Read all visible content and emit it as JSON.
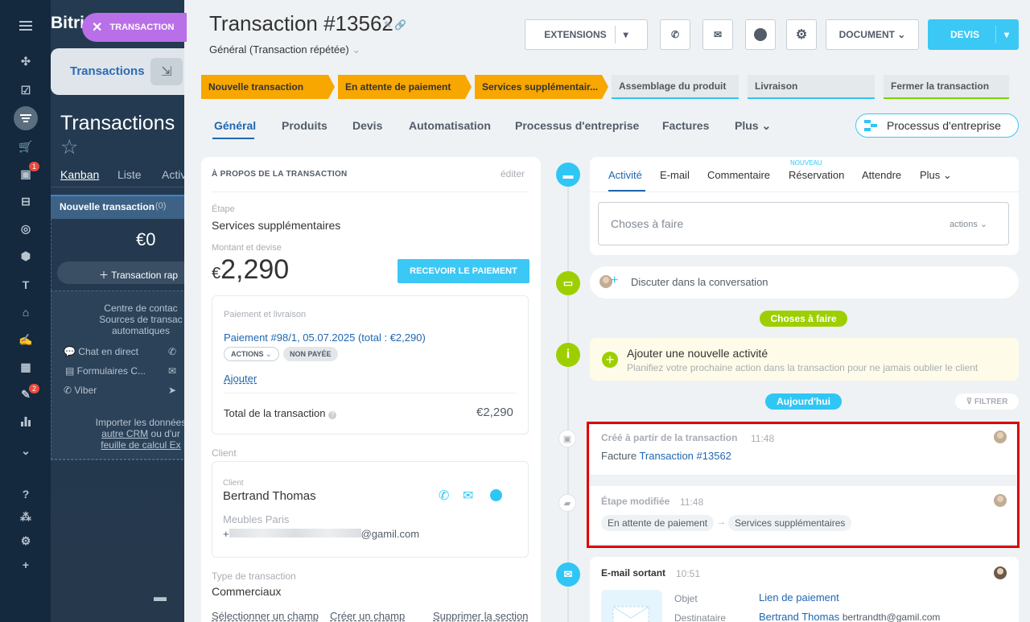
{
  "app": {
    "logo": "Bitri"
  },
  "sidebar_icons": [
    "menu-icon",
    "sites-icon",
    "tasks-icon",
    "crm-icon",
    "shop-icon",
    "contact-center-icon",
    "bot-icon",
    "goal-icon",
    "box-icon",
    "text-icon",
    "bank-icon",
    "sign-icon",
    "calendar-icon",
    "edit-icon",
    "analytics-icon",
    "more-icon",
    "help-icon",
    "structure-icon",
    "settings-icon",
    "add-icon",
    "printer-icon"
  ],
  "sidebar_badges": {
    "contact_center": "1",
    "edit": "2"
  },
  "background": {
    "tab_label": "Transactions",
    "page_title": "Transactions",
    "views": [
      "Kanban",
      "Liste",
      "Activ"
    ],
    "column_title": "Nouvelle transaction",
    "column_count": "(0)",
    "column_amount": "€0",
    "quick_add": "Transaction rap",
    "center_lines": [
      "Centre de contac",
      "Sources de transac",
      "automatiques"
    ],
    "sources": [
      "Chat en direct",
      "Formulaires C...",
      "Viber"
    ],
    "import_lines": [
      "Importer les données",
      "autre CRM",
      "ou d'ur",
      "feuille de calcul Ex"
    ]
  },
  "chip": {
    "label": "TRANSACTION"
  },
  "header": {
    "title": "Transaction #13562",
    "subtitle": "Général (Transaction répétée)",
    "extensions_label": "EXTENSIONS",
    "document_label": "DOCUMENT",
    "devis_label": "DEVIS"
  },
  "stages": [
    {
      "label": "Nouvelle transaction",
      "state": "done"
    },
    {
      "label": "En attente de paiement",
      "state": "done"
    },
    {
      "label": "Services supplémentair...",
      "state": "done"
    },
    {
      "label": "Assemblage du produit",
      "state": "todo",
      "underline": "#2fc6f6"
    },
    {
      "label": "Livraison",
      "state": "todo",
      "underline": "#2fc6f6"
    },
    {
      "label": "Fermer la transaction",
      "state": "todo",
      "underline": "#7bd500"
    }
  ],
  "tabs": [
    "Général",
    "Produits",
    "Devis",
    "Automatisation",
    "Processus d'entreprise",
    "Factures",
    "Plus"
  ],
  "process_button": "Processus d'entreprise",
  "about": {
    "section_title": "À PROPOS DE LA TRANSACTION",
    "edit_label": "éditer",
    "stage_label": "Étape",
    "stage_value": "Services supplémentaires",
    "amount_label": "Montant et devise",
    "currency": "€",
    "amount": "2,290",
    "receive_payment": "RECEVOIR LE PAIEMENT",
    "payment_section": "Paiement et livraison",
    "payment_link": "Paiement #98/1, 05.07.2025 (total : €2,290)",
    "actions_pill": "ACTIONS",
    "unpaid_pill": "NON PAYÉE",
    "add_link": "Ajouter",
    "total_label": "Total de la transaction",
    "total_value": "€2,290",
    "client_section": "Client",
    "client_label": "Client",
    "client_name": "Bertrand Thomas",
    "company": "Meubles Paris",
    "email_suffix": "@gamil.com",
    "type_label": "Type de transaction",
    "type_value": "Commerciaux",
    "footer_links": [
      "Sélectionner un champ",
      "Créer un champ",
      "Supprimer la section"
    ]
  },
  "activity": {
    "tabs": [
      "Activité",
      "E-mail",
      "Commentaire",
      "Réservation",
      "Attendre",
      "Plus"
    ],
    "new_badge": "NOUVEAU",
    "todo_placeholder": "Choses à faire",
    "actions_label": "actions",
    "chat_label": "Discuter dans la conversation",
    "marker_todo": "Choses à faire",
    "add_title": "Ajouter une nouvelle activité",
    "add_subtitle": "Planifiez votre prochaine action dans la transaction pour ne jamais oublier le client",
    "marker_today": "Aujourd'hui",
    "filter_label": "FILTRER"
  },
  "events": [
    {
      "title": "Créé à partir de la transaction",
      "time": "11:48",
      "prefix": "Facture",
      "link": "Transaction #13562"
    },
    {
      "title": "Étape modifiée",
      "time": "11:48",
      "from": "En attente de paiement",
      "to": "Services supplémentaires"
    },
    {
      "title": "E-mail sortant",
      "time": "10:51",
      "subject_label": "Objet",
      "subject_value": "Lien de paiement",
      "recipient_label": "Destinataire",
      "recipient_name": "Bertrand Thomas",
      "recipient_email": "bertrandth@gamil.com"
    }
  ],
  "colors": {
    "accent": "#2067b0",
    "stage_done": "#f7a700",
    "primary_button": "#3bc8f5",
    "highlight": "#e00000",
    "marker_green": "#9dcf00"
  }
}
